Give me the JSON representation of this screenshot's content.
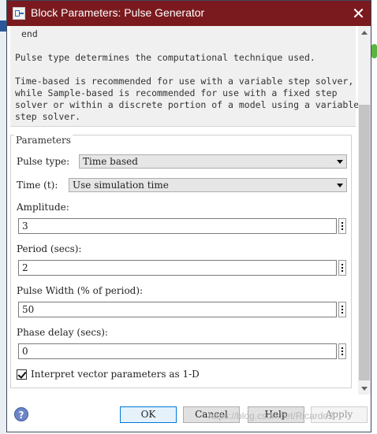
{
  "window": {
    "title": "Block Parameters: Pulse Generator",
    "close_glyph": "✕",
    "icon": "simulink-block-icon"
  },
  "description": {
    "code_tail": "end",
    "para1": "Pulse type determines the computational technique used.",
    "para2": "Time-based is recommended for use with a variable step solver,\nwhile Sample-based is recommended for use with a fixed step\nsolver or within a discrete portion of a model using a variable\nstep solver."
  },
  "parameters": {
    "group_title": "Parameters",
    "pulse_type": {
      "label": "Pulse type:",
      "value": "Time based"
    },
    "time": {
      "label": "Time (t):",
      "value": "Use simulation time"
    },
    "amplitude": {
      "label": "Amplitude:",
      "value": "3"
    },
    "period": {
      "label": "Period (secs):",
      "value": "2"
    },
    "pulse_width": {
      "label": "Pulse Width (% of period):",
      "value": "50"
    },
    "phase_delay": {
      "label": "Phase delay (secs):",
      "value": "0"
    },
    "interpret_vector": {
      "label": "Interpret vector parameters as 1-D",
      "checked": true
    }
  },
  "footer": {
    "help_icon_glyph": "?",
    "ok": "OK",
    "cancel": "Cancel",
    "help": "Help",
    "apply": "Apply",
    "watermark": "https://blog.csdn.net/Ricardo2"
  },
  "colors": {
    "titlebar": "#7a1a1f",
    "description_bg": "#f0f0f0",
    "ok_border": "#0078d7"
  }
}
